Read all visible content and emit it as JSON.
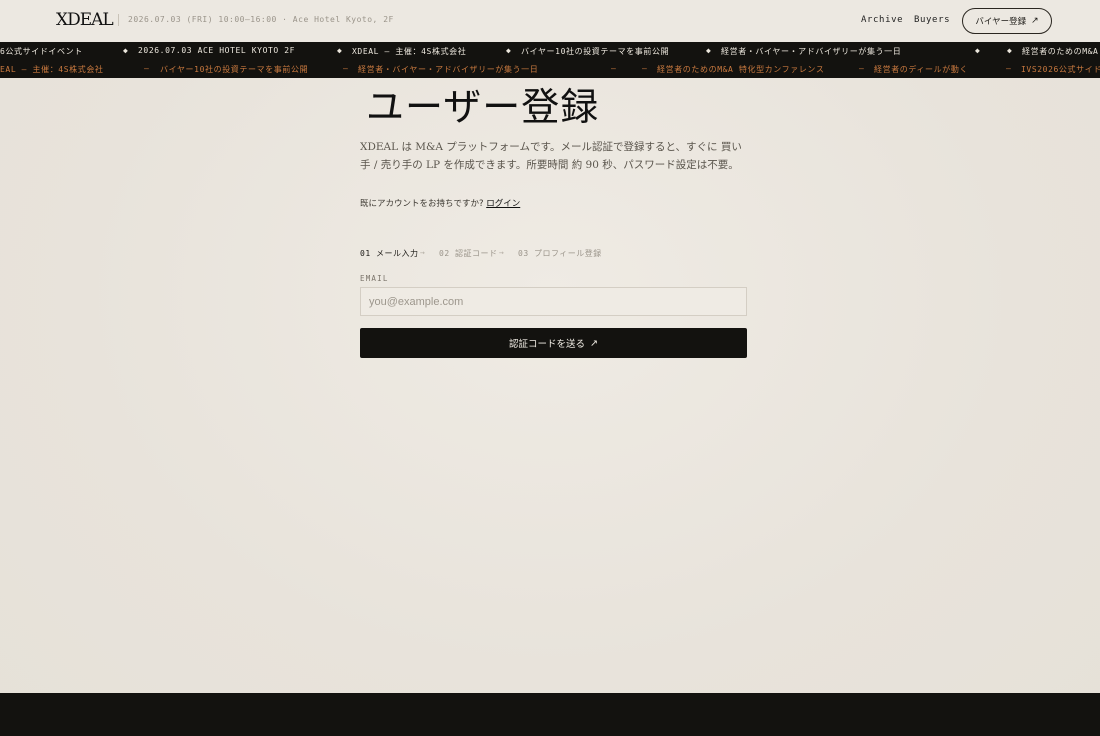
{
  "header": {
    "logo": "XDEAL",
    "event_info": "2026.07.03 (FRI) 10:00–16:00 · Ace Hotel Kyoto, 2F",
    "nav": [
      {
        "label": "Archive"
      },
      {
        "label": "Buyers"
      }
    ],
    "cta_label": "バイヤー登録",
    "cta_arrow": "↗"
  },
  "ticker": {
    "row1": [
      "6公式サイドイベント",
      "2026.07.03 ACE HOTEL KYOTO 2F",
      "XDEAL — 主催：4S株式会社",
      "バイヤー10社の投資テーマを事前公開",
      "経営者・バイヤー・アドバイザリーが集う一日",
      "経営者のためのM&A"
    ],
    "row1_sep": "◆",
    "row2": [
      "EAL — 主催：4S株式会社",
      "バイヤー10社の投資テーマを事前公開",
      "経営者・バイヤー・アドバイザリーが集う一日",
      "経営者のためのM&A 特化型カンファレンス",
      "経営者のディールが動く",
      "IVS2026公式サイド"
    ],
    "row2_sep": "—"
  },
  "main": {
    "title": "ユーザー登録",
    "intro": "XDEAL は M&A プラットフォームです。メール認証で登録すると、すぐに 買い手 / 売り手の LP を作成できます。所要時間 約 90 秒、パスワード設定は不要。",
    "login_prompt": "既にアカウントをお持ちですか?",
    "login_link": "ログイン",
    "steps": [
      {
        "label": "01 メール入力",
        "active": true
      },
      {
        "label": "02 認証コード",
        "active": false
      },
      {
        "label": "03 プロフィール登録",
        "active": false
      }
    ],
    "step_arrow": "→",
    "email_label": "EMAIL",
    "email_placeholder": "you@example.com",
    "submit_label": "認証コードを送る",
    "submit_arrow": "↗"
  },
  "colors": {
    "background": "#ece8e1",
    "dark": "#13120f",
    "accent": "#c9793f"
  }
}
